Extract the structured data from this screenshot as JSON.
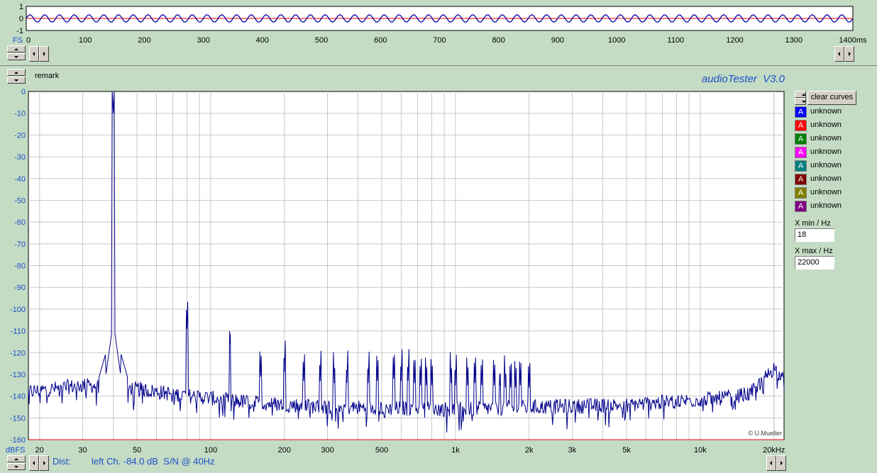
{
  "app_title": "audioTester  V3.0",
  "remark_label": "remark",
  "copyright": "© U.Mueller",
  "status": {
    "prefix": "Dist:",
    "text": "left Ch. -84.0 dB  S/N @ 40Hz"
  },
  "controls": {
    "clear_curves": "clear curves",
    "xmin_label": "X min / Hz",
    "xmin_value": "18",
    "xmax_label": "X max / Hz",
    "xmax_value": "22000"
  },
  "legend": [
    {
      "letter": "A",
      "label": "unknown",
      "color": "#0000ff"
    },
    {
      "letter": "A",
      "label": "unknown",
      "color": "#ff0000"
    },
    {
      "letter": "A",
      "label": "unknown",
      "color": "#008000"
    },
    {
      "letter": "A",
      "label": "unknown",
      "color": "#ff00ff"
    },
    {
      "letter": "A",
      "label": "unknown",
      "color": "#008080"
    },
    {
      "letter": "A",
      "label": "unknown",
      "color": "#800000"
    },
    {
      "letter": "A",
      "label": "unknown",
      "color": "#808000"
    },
    {
      "letter": "A",
      "label": "unknown",
      "color": "#800080"
    }
  ],
  "chart_data": [
    {
      "type": "line",
      "scope": "time",
      "ylabel": "FS",
      "y_ticks": [
        "1",
        "0",
        "-1"
      ],
      "x_ticks": [
        "0",
        "100",
        "200",
        "300",
        "400",
        "500",
        "600",
        "700",
        "800",
        "900",
        "1000",
        "1100",
        "1200",
        "1300",
        "1400ms"
      ],
      "xlim": [
        0,
        1400
      ],
      "ylim": [
        -1,
        1
      ],
      "signal": {
        "frequency_hz": 40,
        "amplitude": 0.3
      },
      "colors": {
        "signal": "#0000a0",
        "zero_line": "#ff0000"
      }
    },
    {
      "type": "line",
      "scope": "spectrum",
      "ylabel": "dBFS",
      "x_scale": "log",
      "xlim": [
        18,
        22000
      ],
      "ylim": [
        -160,
        0
      ],
      "y_ticks": [
        "0",
        "-10",
        "-20",
        "-30",
        "-40",
        "-50",
        "-60",
        "-70",
        "-80",
        "-90",
        "-100",
        "-110",
        "-120",
        "-130",
        "-140",
        "-150",
        "-160"
      ],
      "x_ticks": [
        {
          "v": 20,
          "label": "20"
        },
        {
          "v": 30,
          "label": "30"
        },
        {
          "v": 50,
          "label": "50"
        },
        {
          "v": 100,
          "label": "100"
        },
        {
          "v": 200,
          "label": "200"
        },
        {
          "v": 300,
          "label": "300"
        },
        {
          "v": 500,
          "label": "500"
        },
        {
          "v": 1000,
          "label": "1k"
        },
        {
          "v": 2000,
          "label": "2k"
        },
        {
          "v": 3000,
          "label": "3k"
        },
        {
          "v": 5000,
          "label": "5k"
        },
        {
          "v": 10000,
          "label": "10k"
        },
        {
          "v": 20000,
          "label": "20kHz"
        }
      ],
      "grid": true,
      "series": [
        {
          "color": "#00008b",
          "noise_floor": [
            [
              18,
              -138
            ],
            [
              30,
              -135
            ],
            [
              45,
              -136
            ],
            [
              70,
              -139
            ],
            [
              150,
              -143
            ],
            [
              300,
              -145
            ],
            [
              1000,
              -146
            ],
            [
              5000,
              -144
            ],
            [
              12000,
              -141
            ],
            [
              16000,
              -139
            ],
            [
              20000,
              -127
            ],
            [
              22000,
              -133
            ]
          ],
          "peaks": [
            [
              40,
              -10
            ],
            [
              80,
              -109
            ],
            [
              120,
              -116
            ],
            [
              160,
              -131
            ],
            [
              200,
              -129
            ],
            [
              240,
              -133
            ],
            [
              280,
              -133
            ],
            [
              320,
              -134
            ],
            [
              360,
              -134
            ],
            [
              440,
              -134
            ],
            [
              480,
              -133
            ],
            [
              560,
              -132
            ],
            [
              600,
              -133
            ],
            [
              640,
              -133
            ],
            [
              680,
              -134
            ],
            [
              720,
              -135
            ],
            [
              760,
              -135
            ],
            [
              800,
              -135
            ],
            [
              960,
              -134
            ],
            [
              1000,
              -135
            ],
            [
              1120,
              -135
            ],
            [
              1200,
              -134
            ],
            [
              1280,
              -135
            ],
            [
              1440,
              -135
            ],
            [
              1520,
              -135
            ],
            [
              1600,
              -136
            ],
            [
              1680,
              -136
            ],
            [
              1760,
              -136
            ],
            [
              1840,
              -135
            ],
            [
              2000,
              -136
            ]
          ]
        }
      ]
    }
  ]
}
